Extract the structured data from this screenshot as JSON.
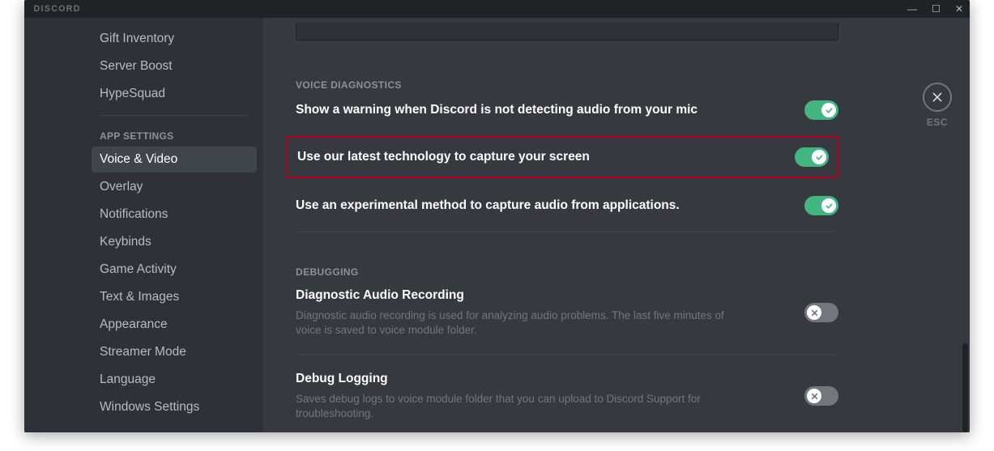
{
  "titlebar": {
    "wordmark": "DISCORD",
    "min": "—",
    "max": "☐",
    "close": "✕"
  },
  "sidebar": {
    "top": [
      "Gift Inventory",
      "Server Boost",
      "HypeSquad"
    ],
    "section_header": "APP SETTINGS",
    "active_index": 0,
    "items": [
      "Voice & Video",
      "Overlay",
      "Notifications",
      "Keybinds",
      "Game Activity",
      "Text & Images",
      "Appearance",
      "Streamer Mode",
      "Language",
      "Windows Settings"
    ]
  },
  "content": {
    "esc": "ESC",
    "section1": {
      "header": "VOICE DIAGNOSTICS",
      "settings": [
        {
          "label": "Show a warning when Discord is not detecting audio from your mic",
          "enabled": true
        },
        {
          "label": "Use our latest technology to capture your screen",
          "enabled": true,
          "highlighted": true
        },
        {
          "label": "Use an experimental method to capture audio from applications.",
          "enabled": true
        }
      ]
    },
    "section2": {
      "header": "DEBUGGING",
      "settings": [
        {
          "label": "Diagnostic Audio Recording",
          "desc": "Diagnostic audio recording is used for analyzing audio problems. The last five minutes of voice is saved to voice module folder.",
          "enabled": false
        },
        {
          "label": "Debug Logging",
          "desc": "Saves debug logs to voice module folder that you can upload to Discord Support for troubleshooting.",
          "enabled": false
        }
      ]
    }
  },
  "colors": {
    "bg_primary": "#36393f",
    "bg_secondary": "#2f3136",
    "bg_tertiary": "#202225",
    "toggle_on": "#43b581",
    "toggle_off": "#72767d",
    "highlight_border": "#b3001b"
  }
}
